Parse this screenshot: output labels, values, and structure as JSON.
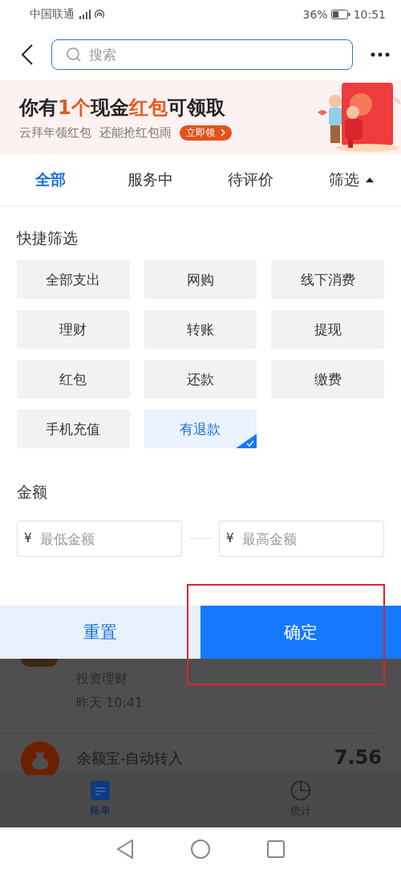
{
  "status_bar": {
    "carrier": "中国联通",
    "battery": "36%",
    "time": "10:51"
  },
  "search": {
    "placeholder": "搜索"
  },
  "banner": {
    "title": [
      {
        "text": "你有",
        "highlight": false
      },
      {
        "text": "1个",
        "highlight": true
      },
      {
        "text": "现金",
        "highlight": false
      },
      {
        "text": "红包",
        "highlight": true
      },
      {
        "text": "可领取",
        "highlight": false
      }
    ],
    "subtitle": "云拜年领红包  还能抢红包雨",
    "action": "立即领"
  },
  "tabs": [
    {
      "label": "全部",
      "selected": true,
      "kind": "plain"
    },
    {
      "label": "服务中",
      "selected": false,
      "kind": "plain"
    },
    {
      "label": "待评价",
      "selected": false,
      "kind": "plain"
    },
    {
      "label": "筛选",
      "selected": false,
      "kind": "dropdown",
      "expanded": true
    }
  ],
  "quick_filter": {
    "title": "快捷筛选",
    "options": [
      {
        "label": "全部支出",
        "selected": false
      },
      {
        "label": "网购",
        "selected": false
      },
      {
        "label": "线下消费",
        "selected": false
      },
      {
        "label": "理财",
        "selected": false
      },
      {
        "label": "转账",
        "selected": false
      },
      {
        "label": "提现",
        "selected": false
      },
      {
        "label": "红包",
        "selected": false
      },
      {
        "label": "还款",
        "selected": false
      },
      {
        "label": "缴费",
        "selected": false
      },
      {
        "label": "手机充值",
        "selected": false
      },
      {
        "label": "有退款",
        "selected": true
      }
    ]
  },
  "amount": {
    "title": "金额",
    "currency": "¥",
    "min_placeholder": "最低金额",
    "max_placeholder": "最高金额"
  },
  "buttons": [
    {
      "label": "重置",
      "kind": "secondary"
    },
    {
      "label": "确定",
      "kind": "primary"
    }
  ],
  "list": [
    {
      "category": "投资理财",
      "time": "昨天  10:41"
    },
    {
      "title": "余额宝-自动转入",
      "amount": "7.56"
    }
  ],
  "bottom_tabs": [
    {
      "label": "账单",
      "selected": true
    },
    {
      "label": "统计",
      "selected": false
    }
  ]
}
